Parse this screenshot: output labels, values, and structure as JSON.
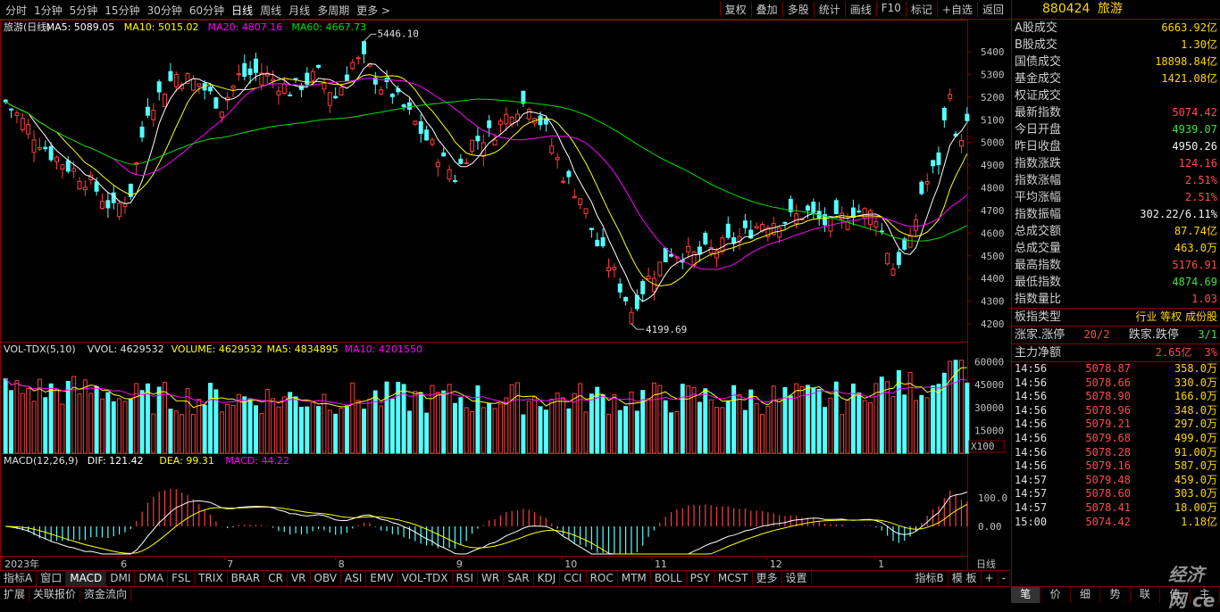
{
  "periods": [
    "分时",
    "1分钟",
    "5分钟",
    "15分钟",
    "30分钟",
    "60分钟",
    "日线",
    "周线",
    "月线",
    "多周期",
    "更多 >"
  ],
  "active_period": 6,
  "tools": [
    "复权",
    "叠加",
    "多股",
    "统计",
    "画线",
    "F10",
    "标记",
    "+自选",
    "返回"
  ],
  "stock": {
    "code": "880424",
    "name": "旅游"
  },
  "main_legend": {
    "title": "旅游(日线)",
    "ma5": "MA5: 5089.05",
    "ma10": "MA10: 5015.02",
    "ma20": "MA20: 4807.16",
    "ma60": "MA60: 4667.73"
  },
  "high_label": "5446.10",
  "low_label": "4199.69",
  "price_axis": [
    "5400",
    "5300",
    "5200",
    "5100",
    "5000",
    "4900",
    "4800",
    "4700",
    "4600",
    "4500",
    "4400",
    "4300",
    "4200"
  ],
  "vol_legend": {
    "title": "VOL-TDX(5,10)",
    "vvol": "VVOL: 4629532",
    "volume": "VOLUME: 4629532",
    "ma5": "MA5: 4834895",
    "ma10": "MA10: 4201550"
  },
  "vol_axis": [
    "60000",
    "45000",
    "30000",
    "15000"
  ],
  "vol_unit": "X100",
  "macd_legend": {
    "title": "MACD(12,26,9)",
    "dif": "DIF: 121.42",
    "dea": "DEA: 99.31",
    "macd": "MACD: 44.22"
  },
  "macd_axis": [
    "100.0",
    "0.00"
  ],
  "x_labels": [
    {
      "t": "2023年",
      "p": 0.002
    },
    {
      "t": "6",
      "p": 0.122
    },
    {
      "t": "7",
      "p": 0.232
    },
    {
      "t": "8",
      "p": 0.347
    },
    {
      "t": "9",
      "p": 0.469
    },
    {
      "t": "10",
      "p": 0.581
    },
    {
      "t": "11",
      "p": 0.674
    },
    {
      "t": "12",
      "p": 0.793
    },
    {
      "t": "1",
      "p": 0.905
    }
  ],
  "x_axis_label": "日线",
  "stats": [
    {
      "label": "A股成交",
      "value": "6663.92亿",
      "c": "yellow"
    },
    {
      "label": "B股成交",
      "value": "1.30亿",
      "c": "yellow"
    },
    {
      "label": "国债成交",
      "value": "18898.84亿",
      "c": "yellow"
    },
    {
      "label": "基金成交",
      "value": "1421.08亿",
      "c": "yellow"
    },
    {
      "label": "权证成交",
      "value": "",
      "c": "yellow"
    },
    {
      "label": "最新指数",
      "value": "5074.42",
      "c": "red"
    },
    {
      "label": "今日开盘",
      "value": "4939.07",
      "c": "green"
    },
    {
      "label": "昨日收盘",
      "value": "4950.26",
      "c": "white"
    },
    {
      "label": "指数涨跌",
      "value": "124.16",
      "c": "red"
    },
    {
      "label": "指数涨幅",
      "value": "2.51%",
      "c": "red"
    },
    {
      "label": "平均涨幅",
      "value": "2.51%",
      "c": "red"
    },
    {
      "label": "指数振幅",
      "value": "302.22/6.11%",
      "c": "white"
    },
    {
      "label": "总成交额",
      "value": "87.74亿",
      "c": "yellow"
    },
    {
      "label": "总成交量",
      "value": "463.0万",
      "c": "yellow"
    },
    {
      "label": "最高指数",
      "value": "5176.91",
      "c": "red"
    },
    {
      "label": "最低指数",
      "value": "4874.69",
      "c": "green"
    },
    {
      "label": "指数量比",
      "value": "1.03",
      "c": "red"
    }
  ],
  "board": {
    "label": "板指类型",
    "value": "行业 等权 成份股"
  },
  "updown": {
    "up_label": "涨家.涨停",
    "up": "20/2",
    "down_label": "跌家.跌停",
    "down": "3/1"
  },
  "net": {
    "label": "主力净额",
    "value": "2.65亿",
    "pct": "3%"
  },
  "ticks": [
    [
      "14:56",
      "5078.87",
      "358.0万"
    ],
    [
      "14:56",
      "5078.66",
      "330.0万"
    ],
    [
      "14:56",
      "5078.90",
      "166.0万"
    ],
    [
      "14:56",
      "5078.96",
      "348.0万"
    ],
    [
      "14:56",
      "5079.21",
      "297.0万"
    ],
    [
      "14:56",
      "5079.68",
      "499.0万"
    ],
    [
      "14:56",
      "5078.28",
      "91.00万"
    ],
    [
      "14:56",
      "5079.16",
      "587.0万"
    ],
    [
      "14:57",
      "5079.48",
      "459.0万"
    ],
    [
      "14:57",
      "5078.60",
      "303.0万"
    ],
    [
      "14:57",
      "5078.41",
      "18.00万"
    ],
    [
      "15:00",
      "5074.42",
      "1.18亿"
    ]
  ],
  "tabs1": [
    "指标A",
    "窗口",
    "MACD",
    "DMI",
    "DMA",
    "FSL",
    "TRIX",
    "BRAR",
    "CR",
    "VR",
    "OBV",
    "ASI",
    "EMV",
    "VOL-TDX",
    "RSI",
    "WR",
    "SAR",
    "KDJ",
    "CCI",
    "ROC",
    "MTM",
    "BOLL",
    "PSY",
    "MCST",
    "更多",
    "设置"
  ],
  "tabs1_active": 2,
  "tabs1_right": [
    "指标B",
    "模 板",
    "+",
    "-"
  ],
  "tabs2": [
    "扩展",
    "关联报价",
    "资金流向"
  ],
  "rtabs": [
    "笔",
    "价",
    "细",
    "势",
    "联",
    "值",
    "主"
  ],
  "rtabs_active": 0,
  "watermark": "经济网 ce",
  "colors": {
    "up": "#ff3c3c",
    "down": "#54ffff",
    "ma5": "#ffffff",
    "ma10": "#ffff00",
    "ma20": "#ff00ff",
    "ma60": "#00e000",
    "grid": "#8b0000"
  }
}
